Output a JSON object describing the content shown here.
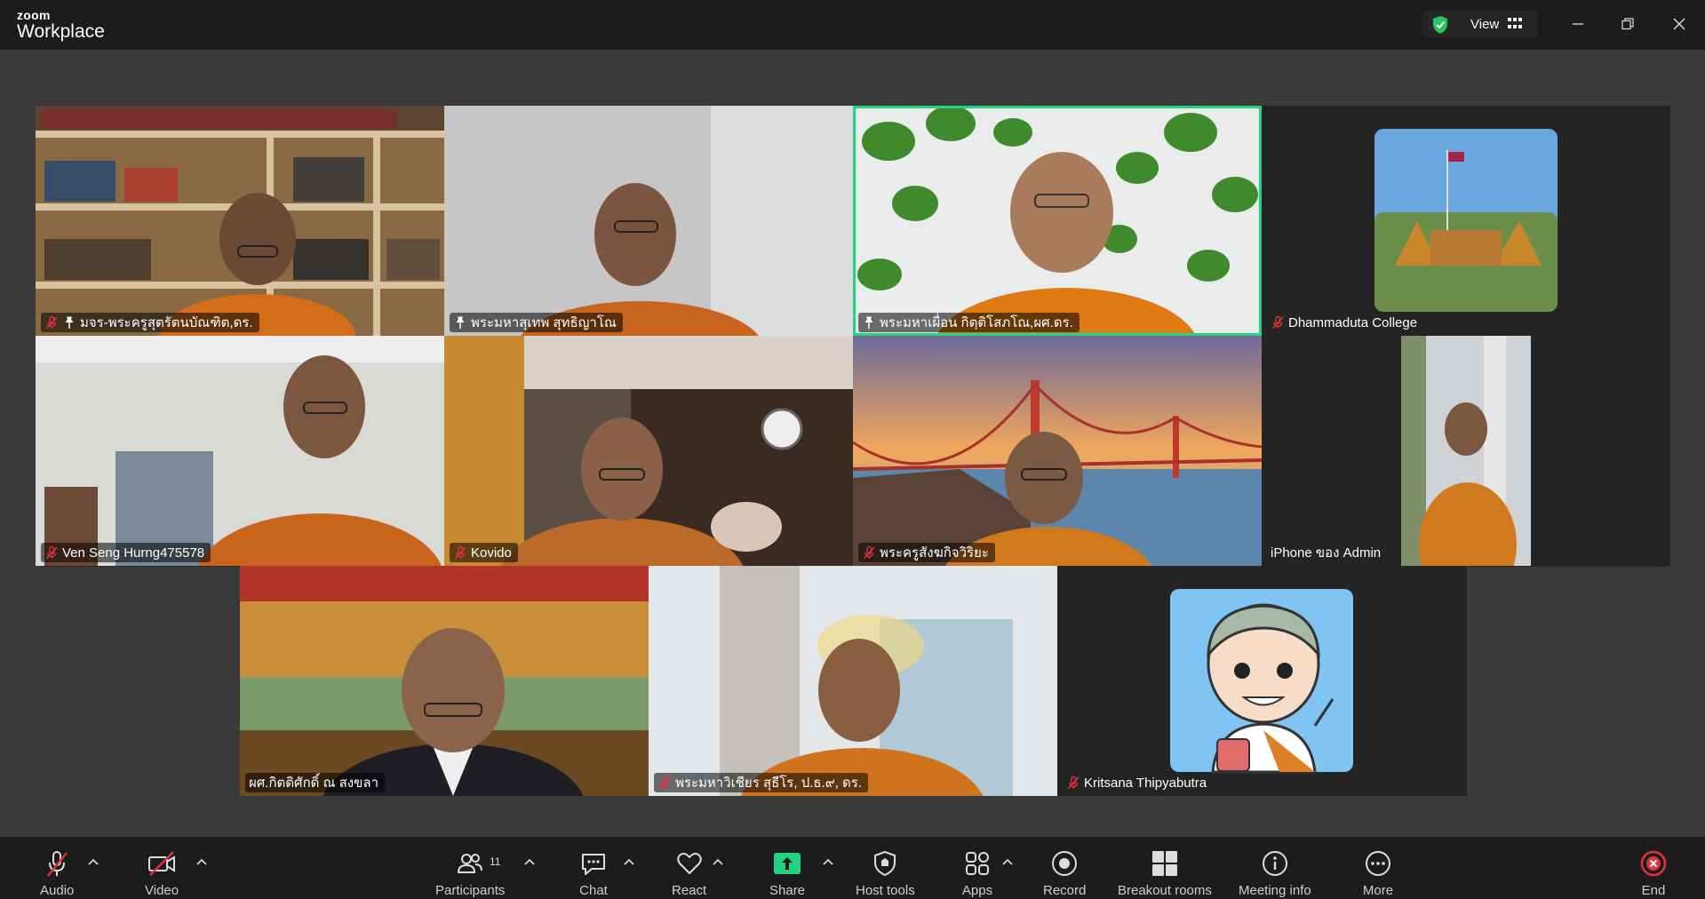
{
  "app": {
    "brand_small": "zoom",
    "brand_name": "Workplace"
  },
  "titlebar": {
    "view_label": "View"
  },
  "tiles": [
    {
      "label": "มจร-พระครูสุตรัตนบัณฑิต,ดร.",
      "muted": true,
      "pinned": true,
      "speaking": false
    },
    {
      "label": "พระมหาสุเทพ สุทธิญาโณ",
      "muted": false,
      "pinned": true,
      "speaking": false
    },
    {
      "label": "พระมหาเผื่อน กิตฺติโสภโณ,ผศ.ดร.",
      "muted": false,
      "pinned": true,
      "speaking": true
    },
    {
      "label": "Dhammaduta College",
      "muted": true,
      "pinned": false,
      "speaking": false
    },
    {
      "label": "Ven Seng Hurng475578",
      "muted": true,
      "pinned": false,
      "speaking": false
    },
    {
      "label": "Kovido",
      "muted": true,
      "pinned": false,
      "speaking": false
    },
    {
      "label": "พระครูสังฆกิจวิริยะ",
      "muted": true,
      "pinned": false,
      "speaking": false
    },
    {
      "label": "iPhone ของ Admin",
      "muted": false,
      "pinned": false,
      "speaking": false
    },
    {
      "label": "ผศ.กิตติศักดิ์ ณ สงขลา",
      "muted": false,
      "pinned": false,
      "speaking": false
    },
    {
      "label": "พระมหาวิเชียร สุธีโร, ป.ธ.๙, ดร.",
      "muted": true,
      "pinned": false,
      "speaking": false
    },
    {
      "label": "Kritsana Thipyabutra",
      "muted": true,
      "pinned": false,
      "speaking": false
    }
  ],
  "toolbar": {
    "audio": "Audio",
    "video": "Video",
    "participants": "Participants",
    "participants_count": "11",
    "chat": "Chat",
    "react": "React",
    "share": "Share",
    "host_tools": "Host tools",
    "apps": "Apps",
    "record": "Record",
    "breakout_rooms": "Breakout rooms",
    "meeting_info": "Meeting info",
    "more": "More",
    "end": "End"
  },
  "colors": {
    "speaking_border": "#22d382",
    "share_green": "#22d382",
    "mute_red": "#e0323c",
    "end_red": "#e0323c"
  }
}
